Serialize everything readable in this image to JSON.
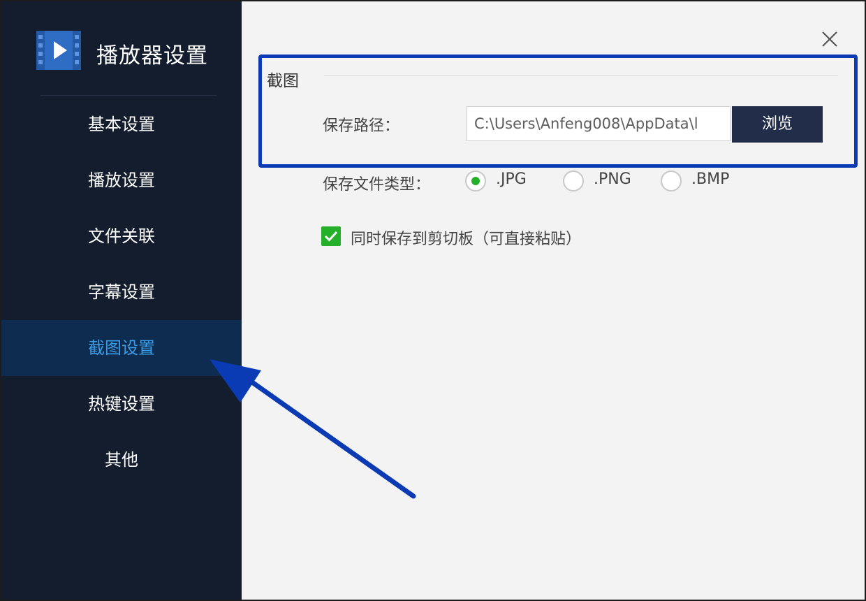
{
  "app": {
    "title": "播放器设置",
    "icon": "video-player-icon"
  },
  "sidebar": {
    "items": [
      {
        "label": "基本设置",
        "active": false
      },
      {
        "label": "播放设置",
        "active": false
      },
      {
        "label": "文件关联",
        "active": false
      },
      {
        "label": "字幕设置",
        "active": false
      },
      {
        "label": "截图设置",
        "active": true
      },
      {
        "label": "热键设置",
        "active": false
      },
      {
        "label": "其他",
        "active": false
      }
    ]
  },
  "screenshot": {
    "section_title": "截图",
    "save_path_label": "保存路径：",
    "save_path_value": "C:\\Users\\Anfeng008\\AppData\\l",
    "browse_label": "浏览",
    "file_type_label": "保存文件类型：",
    "file_types": [
      {
        "label": ".JPG",
        "selected": true
      },
      {
        "label": ".PNG",
        "selected": false
      },
      {
        "label": ".BMP",
        "selected": false
      }
    ],
    "clipboard_label": "同时保存到剪切板（可直接粘贴）",
    "clipboard_checked": true
  },
  "colors": {
    "sidebar_bg": "#131d2e",
    "active_bg": "#0d2c4f",
    "active_text": "#3c9ce6",
    "button_bg": "#222e49",
    "green": "#25b02a",
    "annotation_blue": "#0b3bb4"
  }
}
